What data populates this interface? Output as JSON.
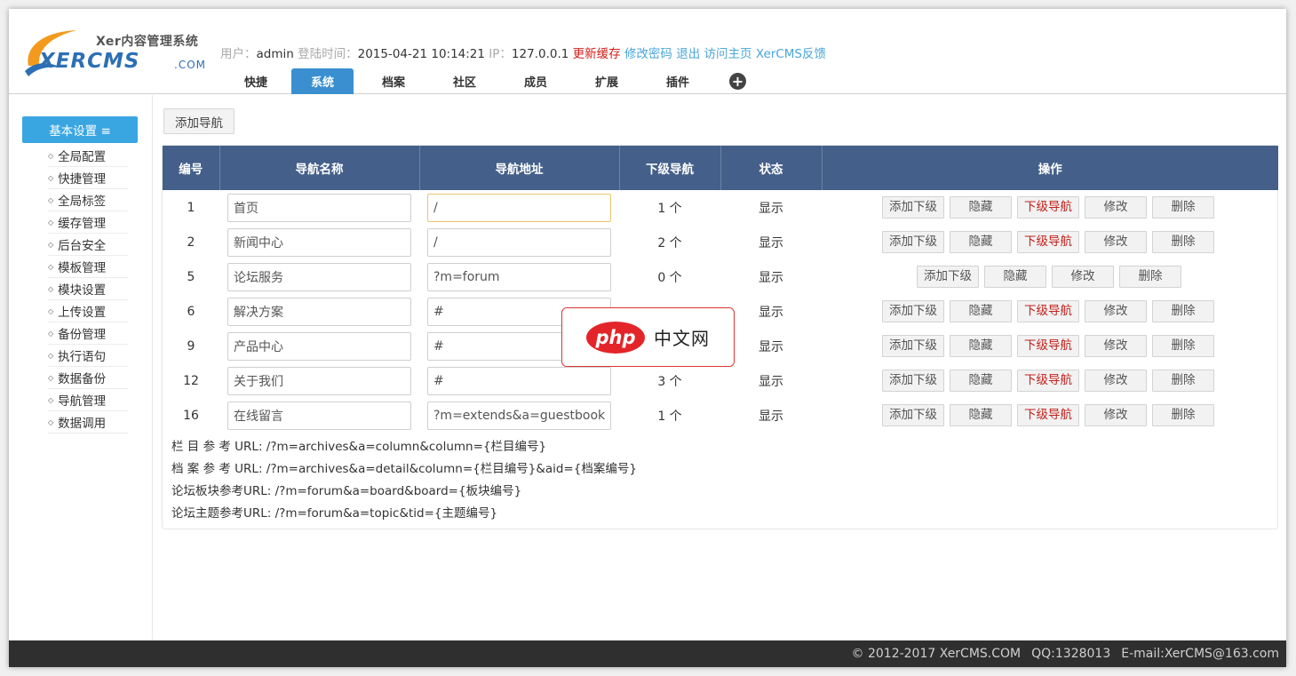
{
  "logo": {
    "subtitle": "Xer内容管理系统",
    "main": "XERCMS",
    "suffix": ".COM"
  },
  "userbar": {
    "user_label": "用户：",
    "user_value": "admin",
    "login_label": "登陆时间：",
    "login_value": "2015-04-21 10:14:21",
    "ip_label": "IP：",
    "ip_value": "127.0.0.1",
    "links": [
      "更新缓存",
      "修改密码",
      "退出",
      "访问主页",
      "XerCMS反馈"
    ]
  },
  "tabs": [
    {
      "label": "快捷"
    },
    {
      "label": "系统"
    },
    {
      "label": "档案"
    },
    {
      "label": "社区"
    },
    {
      "label": "成员"
    },
    {
      "label": "扩展"
    },
    {
      "label": "插件"
    }
  ],
  "active_tab": "系统",
  "tab_add_icon": "+",
  "sidebar": {
    "title": "基本设置 ≡",
    "items": [
      {
        "label": "全局配置"
      },
      {
        "label": "快捷管理"
      },
      {
        "label": "全局标签"
      },
      {
        "label": "缓存管理"
      },
      {
        "label": "后台安全"
      },
      {
        "label": "模板管理"
      },
      {
        "label": "模块设置"
      },
      {
        "label": "上传设置"
      },
      {
        "label": "备份管理"
      },
      {
        "label": "执行语句"
      },
      {
        "label": "数据备份"
      },
      {
        "label": "导航管理"
      },
      {
        "label": "数据调用"
      }
    ]
  },
  "add_nav_button": "添加导航",
  "table": {
    "headers": {
      "id": "编号",
      "name": "导航名称",
      "url": "导航地址",
      "sub": "下级导航",
      "state": "状态",
      "ops": "操作"
    },
    "rows": [
      {
        "id": "1",
        "name": "首页",
        "url": "/",
        "sub": "1 个",
        "state": "显示",
        "has_sub_nav": true
      },
      {
        "id": "2",
        "name": "新闻中心",
        "url": "/",
        "sub": "2 个",
        "state": "显示",
        "has_sub_nav": true
      },
      {
        "id": "5",
        "name": "论坛服务",
        "url": "?m=forum",
        "sub": "0 个",
        "state": "显示",
        "has_sub_nav": false
      },
      {
        "id": "6",
        "name": "解决方案",
        "url": "#",
        "sub": "",
        "state": "显示",
        "has_sub_nav": true
      },
      {
        "id": "9",
        "name": "产品中心",
        "url": "#",
        "sub": "",
        "state": "显示",
        "has_sub_nav": true
      },
      {
        "id": "12",
        "name": "关于我们",
        "url": "#",
        "sub": "3 个",
        "state": "显示",
        "has_sub_nav": true
      },
      {
        "id": "16",
        "name": "在线留言",
        "url": "?m=extends&a=guestbook",
        "sub": "1 个",
        "state": "显示",
        "has_sub_nav": true
      }
    ],
    "ops": {
      "add_sub": "添加下级",
      "hide": "隐藏",
      "sub_nav": "下级导航",
      "edit": "修改",
      "delete": "删除"
    }
  },
  "refs": [
    "栏 目 参 考 URL:  /?m=archives&a=column&column={栏目编号}",
    "档 案 参 考 URL:  /?m=archives&a=detail&column={栏目编号}&aid={档案编号}",
    "论坛板块参考URL:  /?m=forum&a=board&board={板块编号}",
    "论坛主题参考URL:  /?m=forum&a=topic&tid={主题编号}"
  ],
  "watermark": {
    "logo_text": "php",
    "text": "中文网"
  },
  "footer": {
    "copyright": "© 2012-2017 XerCMS.COM",
    "qq": "QQ:1328013",
    "email": "E-mail:XerCMS@163.com"
  },
  "colors": {
    "tab_active": "#3a8fd1",
    "sidebar_head": "#39a6e2",
    "table_header": "#44608a",
    "link_red": "#d0211c",
    "link_blue": "#4aa6d8",
    "footer_bg": "#2f2f2f"
  }
}
